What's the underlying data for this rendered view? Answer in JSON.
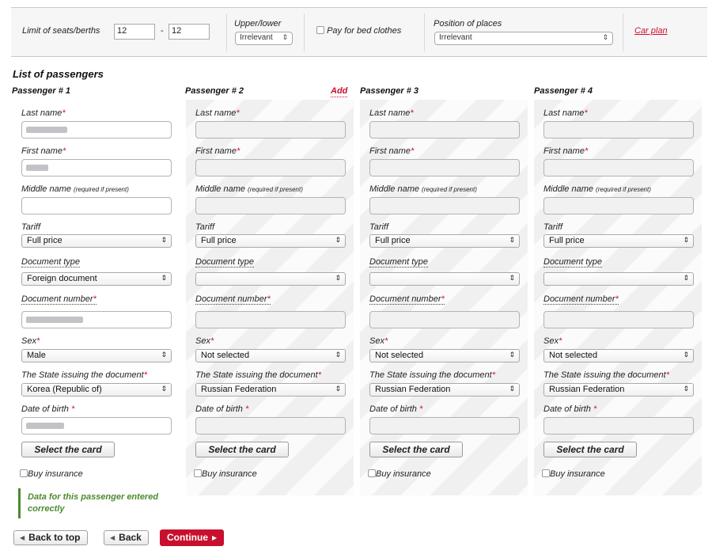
{
  "filters": {
    "seats_label": "Limit of seats/berths",
    "seats_from": "12",
    "seats_dash": "-",
    "seats_to": "12",
    "upper_lower_label": "Upper/lower",
    "upper_lower_value": "Irrelevant",
    "bed_clothes_label": "Pay for bed clothes",
    "position_label": "Position of places",
    "position_value": "Irrelevant",
    "car_plan_label": "Car plan"
  },
  "list_title": "List of passengers",
  "add_label": "Add",
  "field_labels": {
    "last_name": "Last name",
    "first_name": "First name",
    "middle_name": "Middle name",
    "middle_hint": "(required if present)",
    "tariff": "Tariff",
    "document_type": "Document type",
    "document_number": "Document number",
    "sex": "Sex",
    "state": "The State issuing the document",
    "dob": "Date of birth",
    "required_mark": "*"
  },
  "select_card_label": "Select the card",
  "buy_insurance_label": "Buy insurance",
  "passengers": [
    {
      "header": "Passenger # 1",
      "tariff": "Full price",
      "document_type": "Foreign document",
      "sex": "Male",
      "state": "Korea (Republic of)"
    },
    {
      "header": "Passenger # 2",
      "tariff": "Full price",
      "document_type": "",
      "sex": "Not selected",
      "state": "Russian Federation"
    },
    {
      "header": "Passenger # 3",
      "tariff": "Full price",
      "document_type": "",
      "sex": "Not selected",
      "state": "Russian Federation"
    },
    {
      "header": "Passenger # 4",
      "tariff": "Full price",
      "document_type": "",
      "sex": "Not selected",
      "state": "Russian Federation"
    }
  ],
  "passenger_ok_message": "Data for this passenger entered correctly",
  "nav": {
    "back_to_top": "Back to top",
    "back": "Back",
    "continue": "Continue"
  }
}
